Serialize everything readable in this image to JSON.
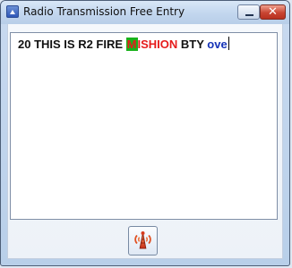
{
  "window": {
    "title": "Radio Transmission Free Entry",
    "minimize_icon": "minimize-icon",
    "close_icon": "close-icon",
    "close_label": "✕"
  },
  "editor": {
    "segments": [
      {
        "text": "20 THIS IS R2 FIRE ",
        "color": "#111111"
      },
      {
        "text": "M",
        "color": "#e61b1b",
        "highlight": "#19b21b"
      },
      {
        "text": "ISHION",
        "color": "#e61b1b"
      },
      {
        "text": " BTY ",
        "color": "#111111"
      },
      {
        "text": "ove",
        "color": "#1533b7"
      }
    ]
  },
  "actions": {
    "transmit_icon": "radio-tower-icon"
  },
  "colors": {
    "highlight_green": "#19b21b",
    "error_red": "#e61b1b",
    "text_blue": "#1533b7",
    "window_blue": "#c2d6ee"
  }
}
